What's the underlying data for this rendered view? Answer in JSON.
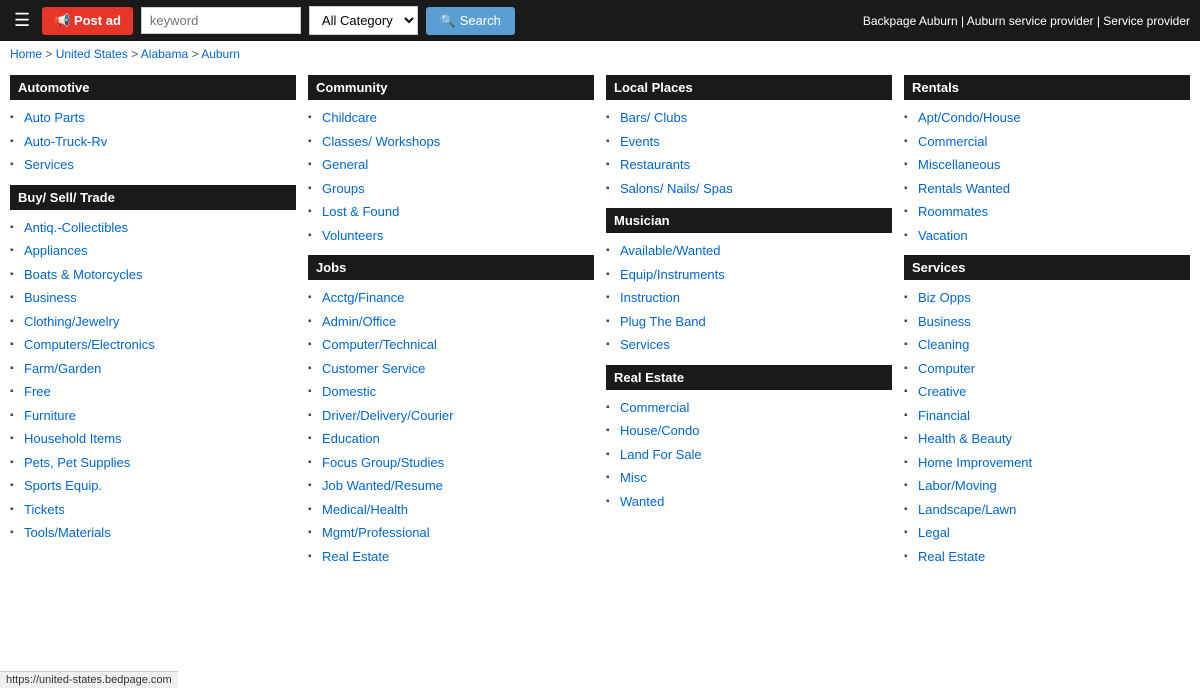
{
  "header": {
    "menu_icon": "☰",
    "post_ad_label": "📢 Post ad",
    "search_placeholder": "keyword",
    "search_button_label": "🔍 Search",
    "category_default": "All Category",
    "nav_links": "Backpage Auburn | Auburn service provider | Service provider"
  },
  "breadcrumb": {
    "text": "Home > United States > Alabama > Auburn",
    "items": [
      "Home",
      "United States",
      "Alabama",
      "Auburn"
    ]
  },
  "columns": {
    "col1": {
      "sections": [
        {
          "title": "Automotive",
          "items": [
            "Auto Parts",
            "Auto-Truck-Rv",
            "Services"
          ]
        },
        {
          "title": "Buy/ Sell/ Trade",
          "items": [
            "Antiq.-Collectibles",
            "Appliances",
            "Boats & Motorcycles",
            "Business",
            "Clothing/Jewelry",
            "Computers/Electronics",
            "Farm/Garden",
            "Free",
            "Furniture",
            "Household Items",
            "Pets, Pet Supplies",
            "Sports Equip.",
            "Tickets",
            "Tools/Materials"
          ]
        }
      ]
    },
    "col2": {
      "sections": [
        {
          "title": "Community",
          "items": [
            "Childcare",
            "Classes/ Workshops",
            "General",
            "Groups",
            "Lost & Found",
            "Volunteers"
          ]
        },
        {
          "title": "Jobs",
          "items": [
            "Acctg/Finance",
            "Admin/Office",
            "Computer/Technical",
            "Customer Service",
            "Domestic",
            "Driver/Delivery/Courier",
            "Education",
            "Focus Group/Studies",
            "Job Wanted/Resume",
            "Medical/Health",
            "Mgmt/Professional",
            "Real Estate"
          ]
        }
      ]
    },
    "col3": {
      "sections": [
        {
          "title": "Local Places",
          "items": [
            "Bars/ Clubs",
            "Events",
            "Restaurants",
            "Salons/ Nails/ Spas"
          ]
        },
        {
          "title": "Musician",
          "items": [
            "Available/Wanted",
            "Equip/Instruments",
            "Instruction",
            "Plug The Band",
            "Services"
          ]
        },
        {
          "title": "Real Estate",
          "items": [
            "Commercial",
            "House/Condo",
            "Land For Sale",
            "Misc",
            "Wanted"
          ]
        }
      ]
    },
    "col4": {
      "sections": [
        {
          "title": "Rentals",
          "items": [
            "Apt/Condo/House",
            "Commercial",
            "Miscellaneous",
            "Rentals Wanted",
            "Roommates",
            "Vacation"
          ]
        },
        {
          "title": "Services",
          "items": [
            "Biz Opps",
            "Business",
            "Cleaning",
            "Computer",
            "Creative",
            "Financial",
            "Health & Beauty",
            "Home Improvement",
            "Labor/Moving",
            "Landscape/Lawn",
            "Legal",
            "Real Estate"
          ]
        }
      ]
    }
  },
  "statusbar": {
    "url": "https://united-states.bedpage.com"
  }
}
